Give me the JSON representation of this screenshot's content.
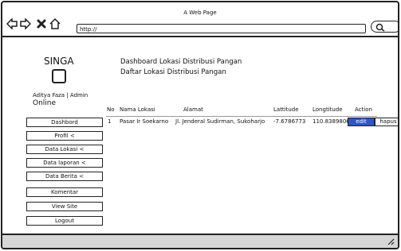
{
  "window": {
    "title": "A Web Page",
    "url": "http://"
  },
  "sidebar": {
    "brand": "SINGA",
    "user_name": "Aditya Faza | Admin",
    "status": "Online",
    "items": [
      {
        "label": "Dashbord"
      },
      {
        "label": "Profil <"
      },
      {
        "label": "Data Lokasi <"
      },
      {
        "label": "Data laporan <"
      },
      {
        "label": "Data Berita <"
      },
      {
        "label": "Komentar"
      },
      {
        "label": "View Site"
      },
      {
        "label": "Logout"
      }
    ]
  },
  "main": {
    "breadcrumb": "Dashboard  Lokasi Distribusi Pangan",
    "subtitle": "Daftar Lokasi Distribusi Pangan",
    "table": {
      "headers": [
        "No",
        "Nama Lokasi",
        "Alamat",
        "Lattitude",
        "Longtitude",
        "Action"
      ],
      "rows": [
        {
          "no": "1",
          "nama": "Pasar Ir Soekarno",
          "alamat": "Jl. Jenderal Sudirman, Sukoharjo",
          "lat": "-7.6786773",
          "lng": "110.8389806",
          "edit_label": "edit",
          "hapus_label": "hapus"
        }
      ]
    }
  },
  "colors": {
    "edit_button": "#2d56c8",
    "statusbar": "#d6d6d6"
  },
  "icons": [
    "back-arrow-icon",
    "forward-arrow-icon",
    "close-icon",
    "home-icon",
    "search-icon",
    "resize-grip-icon"
  ]
}
